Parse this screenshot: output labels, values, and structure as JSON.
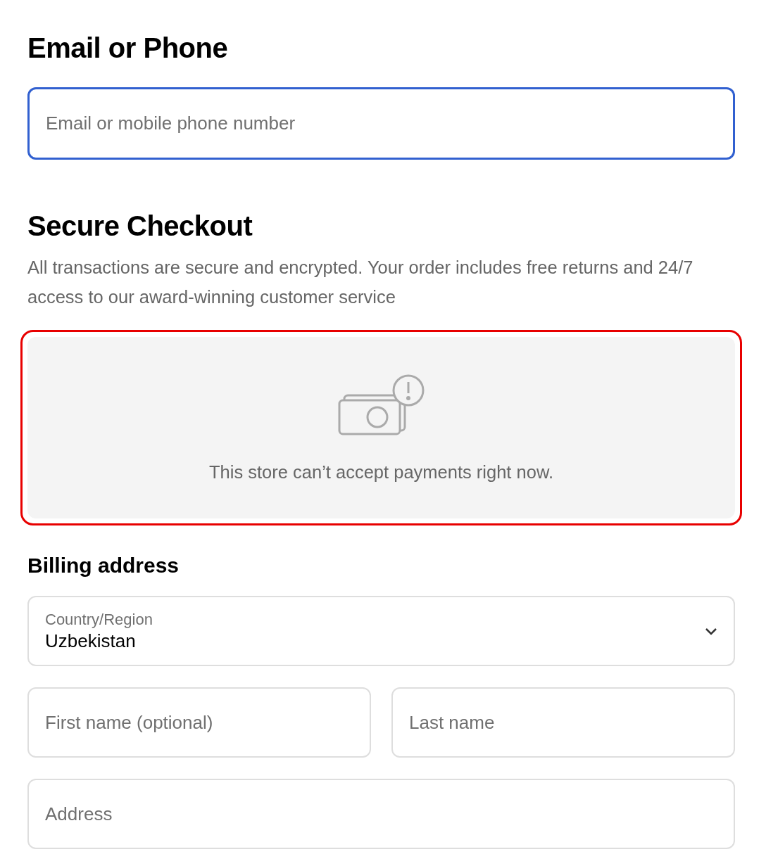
{
  "contact": {
    "heading": "Email or Phone",
    "field": {
      "placeholder": "Email or mobile phone number",
      "focused": true
    }
  },
  "checkout": {
    "heading": "Secure Checkout",
    "description": "All transactions are secure and encrypted. Your order includes free returns and 24/7 access to our award-winning customer service",
    "notice": {
      "message": "This store can’t accept payments right now.",
      "error": true
    }
  },
  "billing": {
    "heading": "Billing address",
    "fields": [
      {
        "kind": "select",
        "label": "Country/Region",
        "value": "Uzbekistan"
      },
      {
        "kind": "pair",
        "items": [
          {
            "placeholder": "First name (optional)"
          },
          {
            "placeholder": "Last name"
          }
        ]
      },
      {
        "kind": "text",
        "placeholder": "Address"
      }
    ]
  }
}
